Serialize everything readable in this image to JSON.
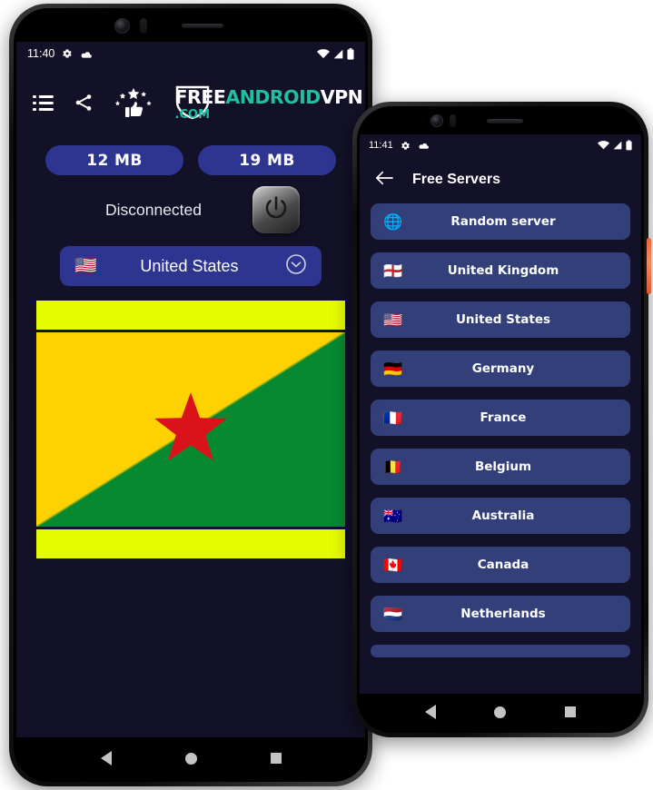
{
  "left_phone": {
    "status_bar": {
      "time": "11:40",
      "icons": [
        "settings-icon",
        "cloud-icon",
        "wifi-icon",
        "signal-icon",
        "battery-icon"
      ]
    },
    "toolbar": {
      "list_icon": "list-icon",
      "share_icon": "share-icon",
      "rate_icon": "thumbs-up-stars-icon"
    },
    "logo": {
      "free": "FREE",
      "android": "ANDROID",
      "vpn": "VPN",
      "com": ".COM",
      "shield": "shield-icon",
      "white": "#ffffff",
      "teal": "#1fbfa0"
    },
    "usage": {
      "download": "12 MB",
      "upload": "19 MB"
    },
    "connection": {
      "status": "Disconnected",
      "power_button": "power-icon"
    },
    "country_selector": {
      "flag": "🇺🇸",
      "name": "United States",
      "chevron": "chevron-down-icon"
    },
    "banner": {
      "name": "french-guiana-flag",
      "top_bar_color": "#e4fb00",
      "bottom_bar_color": "#e4fb00",
      "flag_yellow": "#ffd100",
      "flag_green": "#078930",
      "star_color": "#da121a"
    },
    "nav_bar": {
      "back": "back-triangle-icon",
      "home": "home-circle-icon",
      "recents": "recents-square-icon"
    }
  },
  "right_phone": {
    "status_bar": {
      "time": "11:41",
      "icons": [
        "settings-icon",
        "cloud-icon",
        "wifi-icon",
        "signal-icon",
        "battery-icon"
      ]
    },
    "app_bar": {
      "back_icon": "arrow-left-icon",
      "title": "Free Servers"
    },
    "servers": [
      {
        "flag": "🌐",
        "name": "Random server"
      },
      {
        "flag": "🏴󠁧󠁢󠁥󠁮󠁧󠁿",
        "name": "United Kingdom"
      },
      {
        "flag": "🇺🇸",
        "name": "United States"
      },
      {
        "flag": "🇩🇪",
        "name": "Germany"
      },
      {
        "flag": "🇫🇷",
        "name": "France"
      },
      {
        "flag": "🇧🇪",
        "name": "Belgium"
      },
      {
        "flag": "🇦🇺",
        "name": "Australia"
      },
      {
        "flag": "🇨🇦",
        "name": "Canada"
      },
      {
        "flag": "🇳🇱",
        "name": "Netherlands"
      }
    ],
    "nav_bar": {
      "back": "back-triangle-icon",
      "home": "home-circle-icon",
      "recents": "recents-square-icon"
    },
    "side_button": "power-side-button"
  },
  "theme": {
    "screen_bg": "#121127",
    "pill_blue": "#2d3591",
    "row_blue": "#323f78"
  }
}
